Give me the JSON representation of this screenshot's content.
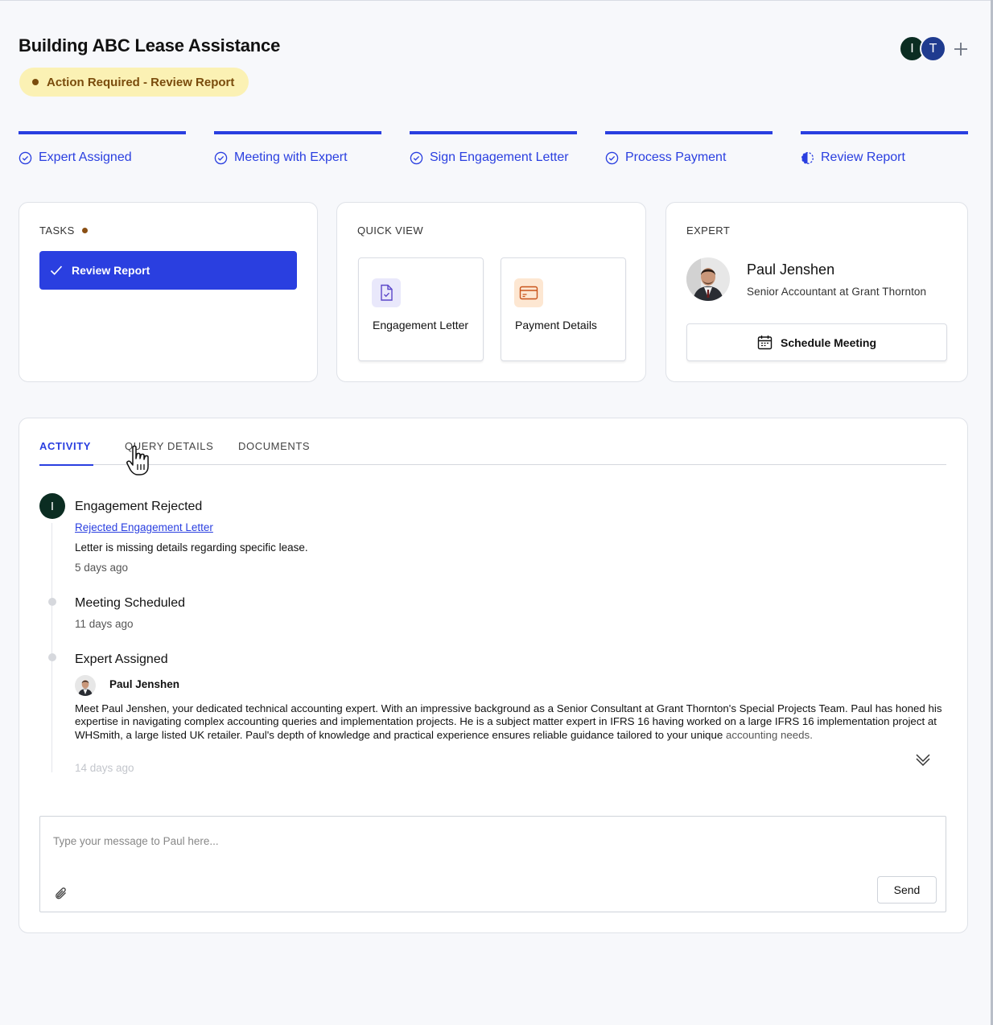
{
  "header": {
    "title": "Building ABC Lease Assistance",
    "status": "Action Required - Review Report",
    "avatars": [
      "I",
      "T"
    ],
    "add_icon": "plus-icon"
  },
  "steps": [
    {
      "label": "Expert Assigned",
      "state": "complete",
      "icon": "check-circle-icon"
    },
    {
      "label": "Meeting with Expert",
      "state": "complete",
      "icon": "check-circle-icon"
    },
    {
      "label": "Sign Engagement Letter",
      "state": "complete",
      "icon": "check-circle-icon"
    },
    {
      "label": "Process Payment",
      "state": "complete",
      "icon": "check-circle-icon"
    },
    {
      "label": "Review Report",
      "state": "in-progress",
      "icon": "half-circle-icon"
    }
  ],
  "tasks": {
    "heading": "TASKS",
    "items": [
      {
        "label": "Review Report",
        "icon": "check-icon"
      }
    ]
  },
  "quick_view": {
    "heading": "QUICK VIEW",
    "tiles": [
      {
        "label": "Engagement Letter",
        "icon": "document-check-icon"
      },
      {
        "label": "Payment Details",
        "icon": "credit-card-icon"
      }
    ]
  },
  "expert": {
    "heading": "EXPERT",
    "name": "Paul Jenshen",
    "role": "Senior Accountant at Grant Thornton",
    "schedule_label": "Schedule Meeting",
    "schedule_icon": "calendar-icon"
  },
  "activity": {
    "tabs": [
      "ACTIVITY",
      "QUERY DETAILS",
      "DOCUMENTS"
    ],
    "active_tab": "ACTIVITY",
    "events": [
      {
        "badge": "I",
        "title": "Engagement Rejected",
        "link": "Rejected Engagement Letter",
        "text": "Letter is missing details regarding specific lease.",
        "time": "5 days ago"
      },
      {
        "title": "Meeting Scheduled",
        "time": "11 days ago"
      },
      {
        "title": "Expert Assigned",
        "author": "Paul Jenshen",
        "bio_main": "Meet Paul Jenshen, your dedicated technical accounting expert. With an impressive background as a Senior Consultant at Grant Thornton's Special Projects Team. Paul has honed his expertise in navigating complex accounting queries and implementation projects. He is a subject matter expert in IFRS 16 having worked on a large IFRS 16 implementation project at WHSmith, a large listed UK retailer. Paul's depth of knowledge and practical experience ensures reliable guidance tailored to your unique",
        "bio_tail": "accounting needs.",
        "time": "14 days ago"
      }
    ],
    "expand_icon": "double-chevron-down-icon"
  },
  "composer": {
    "placeholder": "Type your message to Paul here...",
    "attach_icon": "paperclip-icon",
    "send_label": "Send"
  },
  "colors": {
    "accent": "#2a3fe0",
    "status_bg": "#fbf1b4",
    "status_text": "#7a4c0d",
    "dark_avatar": "#0b2d22",
    "blue_avatar": "#1f3b8f"
  }
}
